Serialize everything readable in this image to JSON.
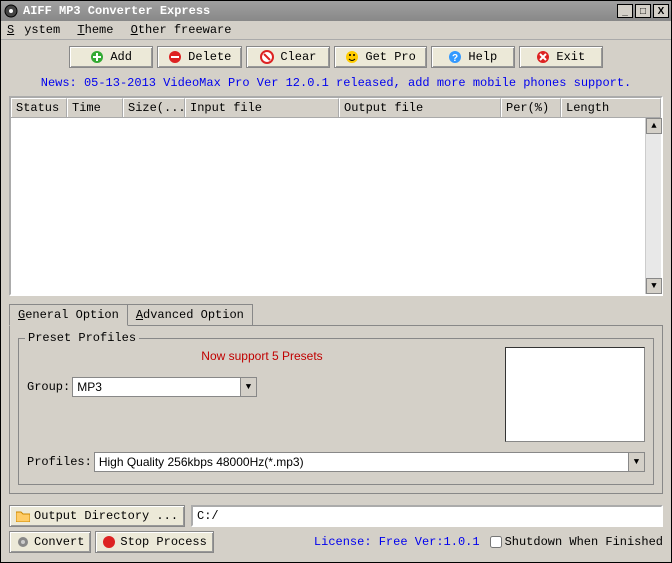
{
  "title": "AIFF MP3 Converter Express",
  "menu": {
    "system": "System",
    "theme": "Theme",
    "other": "Other freeware"
  },
  "toolbar": {
    "add": "Add",
    "delete": "Delete",
    "clear": "Clear",
    "getpro": "Get Pro",
    "help": "Help",
    "exit": "Exit"
  },
  "news": "News: 05-13-2013 VideoMax Pro Ver 12.0.1 released, add more mobile phones support.",
  "columns": {
    "status": "Status",
    "time": "Time",
    "size": "Size(...",
    "input": "Input file",
    "output": "Output file",
    "per": "Per(%)",
    "length": "Length"
  },
  "tabs": {
    "general": "General Option",
    "advanced": "Advanced Option"
  },
  "preset": {
    "legend": "Preset Profiles",
    "support": "Now support 5 Presets",
    "group_label": "Group:",
    "group_value": "MP3",
    "profiles_label": "Profiles:",
    "profiles_value": "High Quality 256kbps 48000Hz(*.mp3)"
  },
  "outdir": {
    "button": "Output Directory ...",
    "path": "C:/"
  },
  "actions": {
    "convert": "Convert",
    "stop": "Stop Process"
  },
  "license": "License: Free Ver:1.0.1",
  "shutdown": "Shutdown When Finished"
}
